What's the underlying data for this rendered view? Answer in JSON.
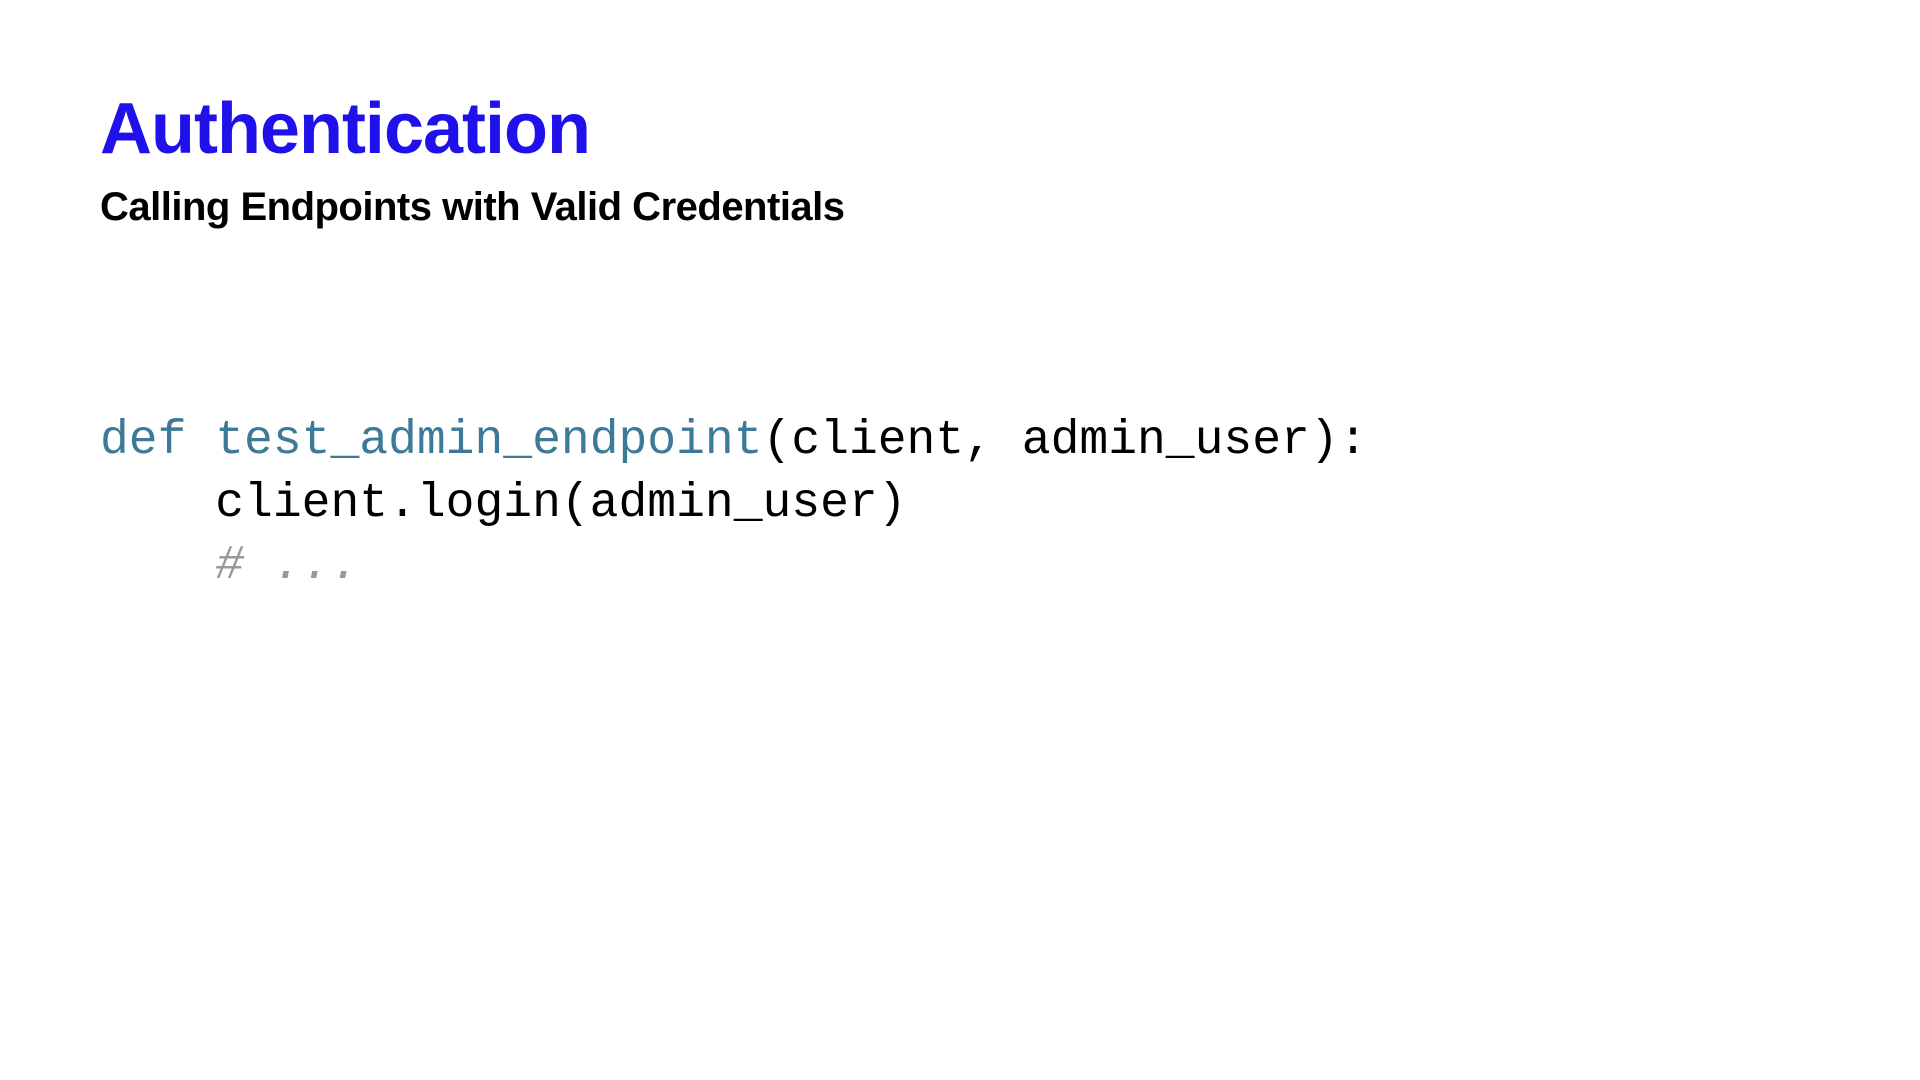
{
  "slide": {
    "title": "Authentication",
    "subtitle": "Calling Endpoints with Valid Credentials",
    "code": {
      "keyword_def": "def",
      "space1": " ",
      "func_name": "test_admin_endpoint",
      "params": "(client, admin_user):",
      "line2_indent": "    ",
      "line2_body": "client.login(admin_user)",
      "line3_indent": "    ",
      "comment": "# ..."
    }
  }
}
